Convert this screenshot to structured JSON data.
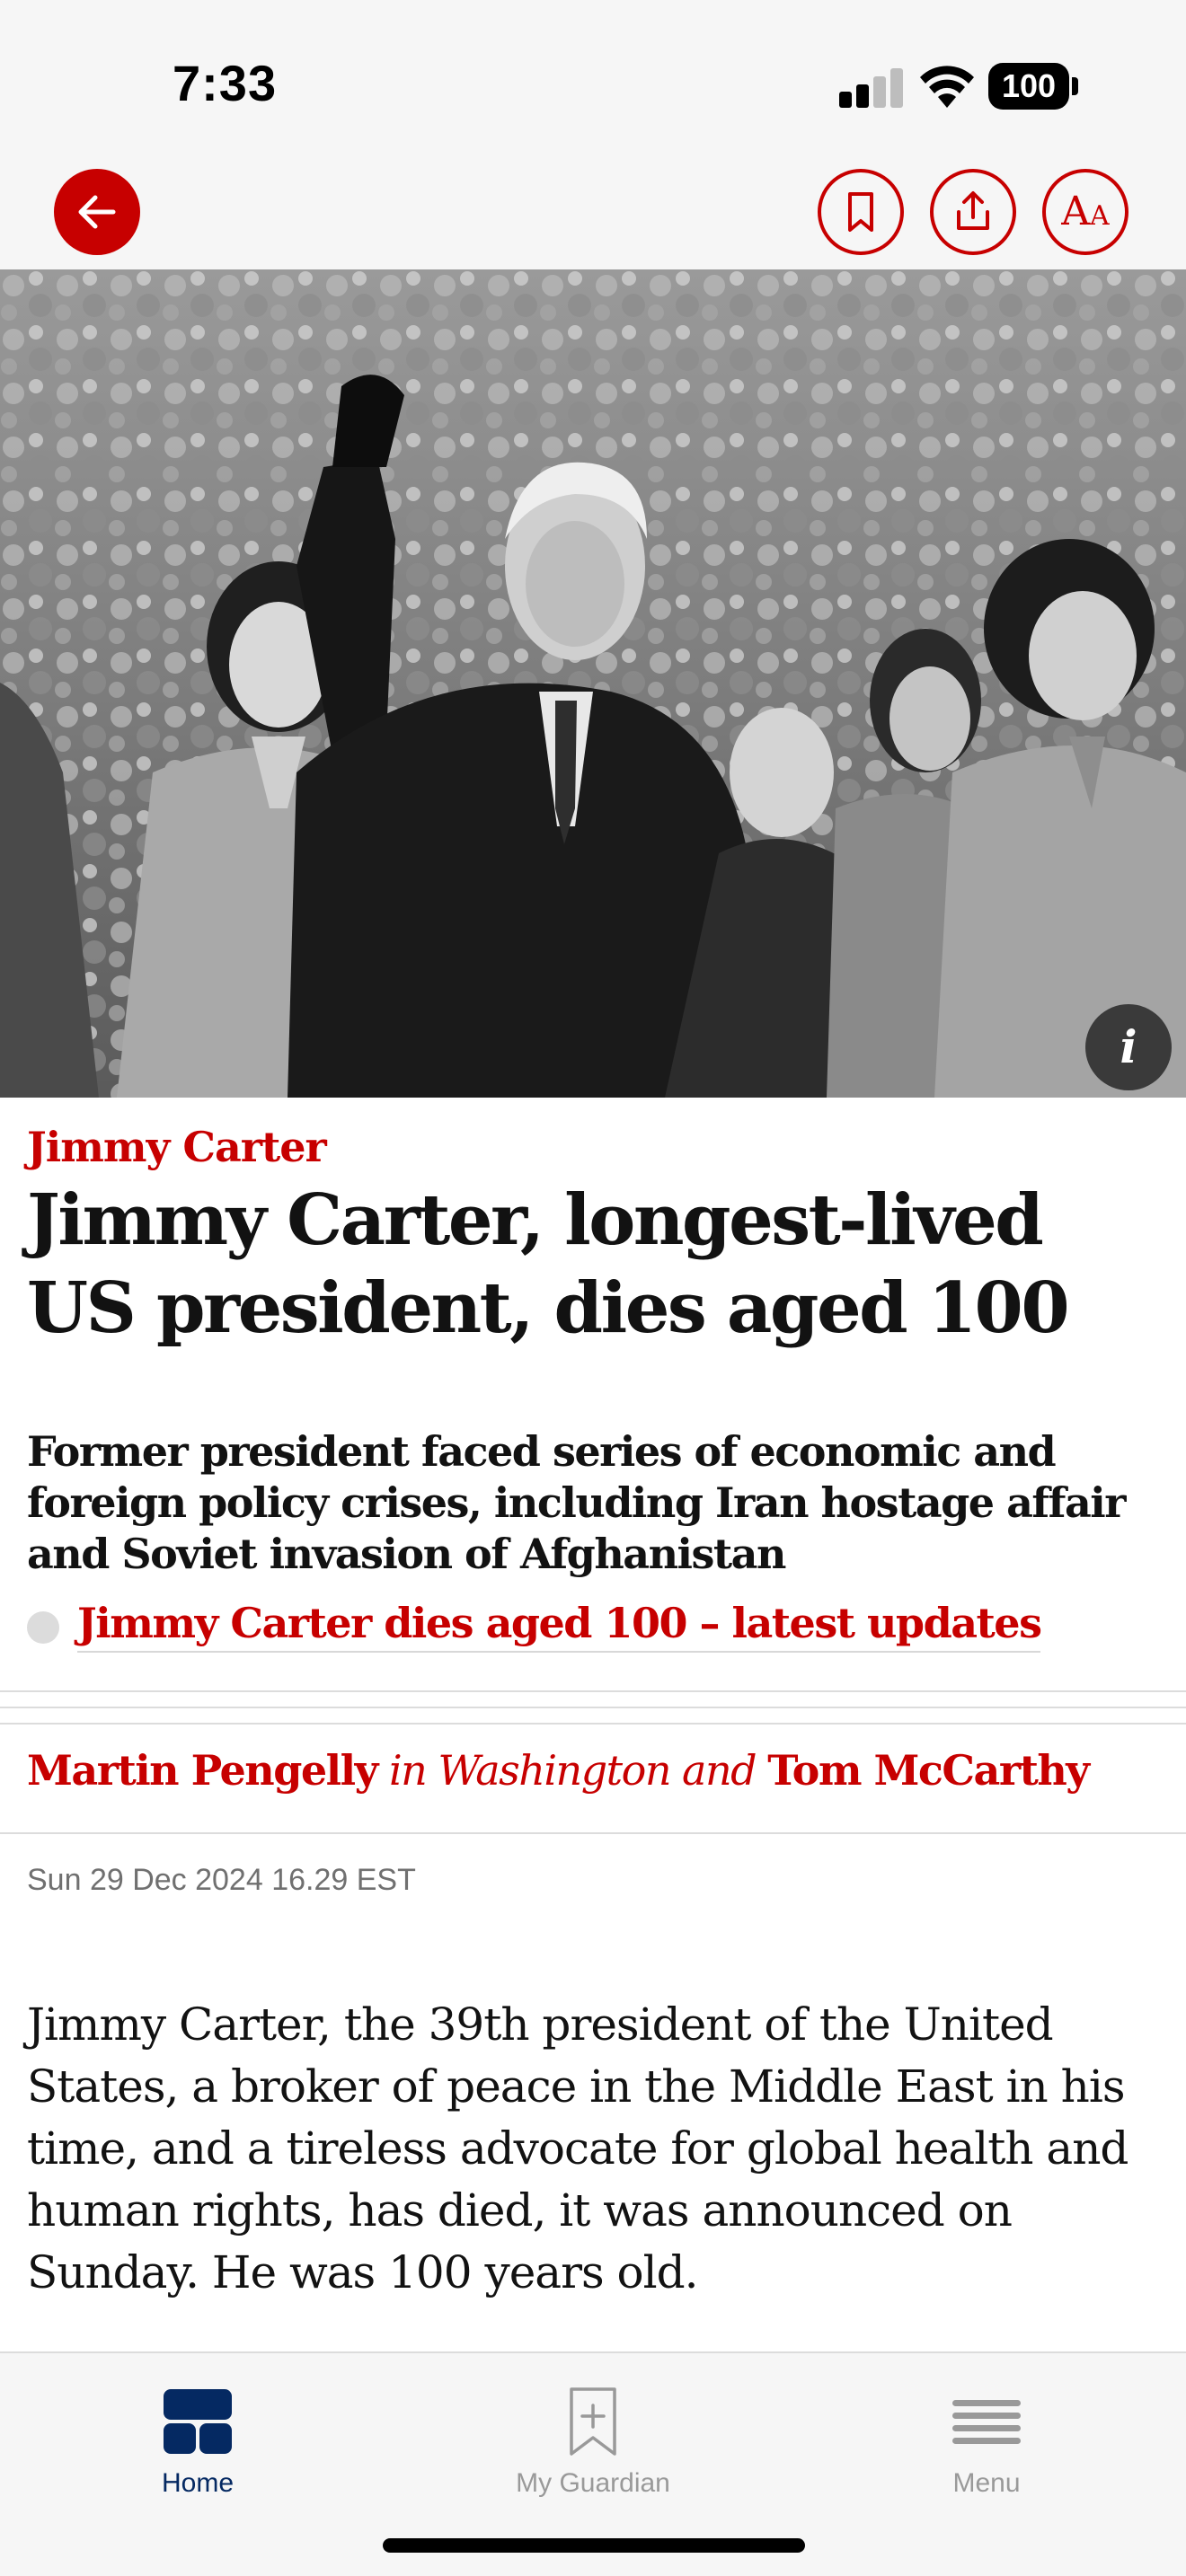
{
  "status_bar": {
    "time": "7:33",
    "battery": "100"
  },
  "toolbar": {
    "back_icon": "arrow-left-icon",
    "bookmark_icon": "bookmark-icon",
    "share_icon": "share-icon",
    "text_size_icon": "text-size-icon",
    "accent_color": "#c70000"
  },
  "hero": {
    "info_label": "i"
  },
  "article": {
    "kicker": "Jimmy Carter",
    "headline": "Jimmy Carter, longest-lived US president, dies aged 100",
    "standfirst": "Former president faced series of economic and foreign policy crises, including Iran hostage affair and Soviet invasion of Afghanistan",
    "live_link": "Jimmy Carter dies aged 100 – latest updates",
    "byline": {
      "author1": "Martin Pengelly",
      "location": " in Washington and ",
      "author2": "Tom McCarthy"
    },
    "dateline": "Sun 29 Dec 2024 16.29 EST",
    "body": "Jimmy Carter, the 39th president of the United States, a broker of peace in the Middle East in his time, and a tireless advocate for global health and human rights, has died, it was announced on Sunday. He was 100 years old."
  },
  "tab_bar": {
    "items": [
      {
        "label": "Home",
        "icon": "home-grid-icon",
        "active": true
      },
      {
        "label": "My Guardian",
        "icon": "bookmark-plus-icon",
        "active": false
      },
      {
        "label": "Menu",
        "icon": "menu-lines-icon",
        "active": false
      }
    ],
    "active_color": "#052962",
    "inactive_color": "#999999"
  }
}
